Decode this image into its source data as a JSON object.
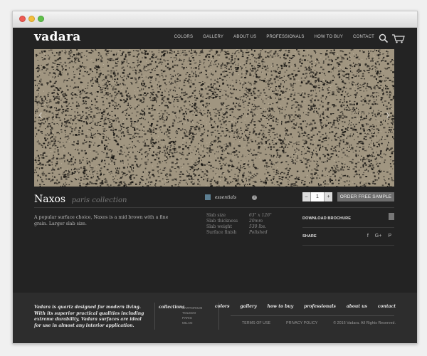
{
  "window": {
    "controls": [
      "close",
      "minimize",
      "maximize"
    ]
  },
  "nav": {
    "logo": "vadara",
    "links": [
      "COLORS",
      "GALLERY",
      "ABOUT US",
      "PROFESSIONALS",
      "HOW TO BUY",
      "CONTACT"
    ],
    "icons": [
      "search-icon",
      "cart-icon"
    ]
  },
  "hero": {
    "prev": "‹",
    "next": "›",
    "colors": {
      "base": "#a09580",
      "speck": "#1a1814"
    }
  },
  "product": {
    "name": "Naxos",
    "collection": "paris collection",
    "line": "essentials",
    "line_color": "#5d7f92",
    "info": "?",
    "description": "A popular surface choice, Naxos is a mid brown with a fine grain. Larger slab size.",
    "specs": [
      {
        "label": "Slab size",
        "value": "63\" x 126\""
      },
      {
        "label": "Slab thickness",
        "value": "20mm"
      },
      {
        "label": "Slab weight",
        "value": "530 lbs."
      },
      {
        "label": "Surface finish",
        "value": "Polished"
      }
    ],
    "qty_minus": "–",
    "qty_value": "1",
    "qty_plus": "+",
    "order_button": "ORDER FREE SAMPLE",
    "download_label": "DOWNLOAD BROCHURE",
    "share_label": "SHARE",
    "share_icons": [
      "f",
      "G+",
      "P"
    ]
  },
  "footer": {
    "about": "Vadara is quartz designed for modern living. With its superior practical qualities including extreme durability, Vadara surfaces are ideal for use in almost any interior application.",
    "collections_label": "collections",
    "collections": [
      "SARTORIUM",
      "TOLEDO",
      "PARIS",
      "MILAN"
    ],
    "links": [
      "colors",
      "gallery",
      "how to buy",
      "professionals",
      "about us",
      "contact"
    ],
    "terms": "TERMS OF USE",
    "privacy": "PRIVACY POLICY",
    "copyright": "© 2016 Vadara. All Rights Reserved."
  }
}
